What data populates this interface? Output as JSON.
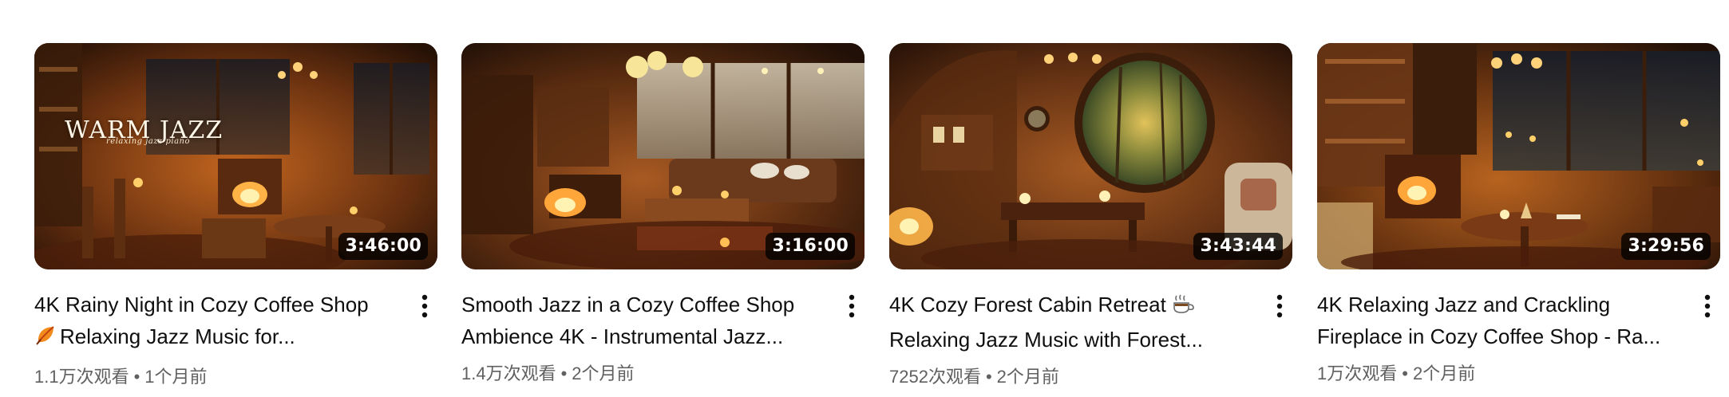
{
  "videos": [
    {
      "thumb_text": "WARM JAZZ",
      "thumb_subtext": "relaxing jazz piano",
      "duration": "3:46:00",
      "title_line1": "4K Rainy Night in Cozy Coffee Shop",
      "title_line2": "Relaxing Jazz Music for...",
      "title_icon": "autumn-leaf-icon",
      "views": "1.1万次观看",
      "separator": "•",
      "age": "1个月前"
    },
    {
      "duration": "3:16:00",
      "title_line1": "Smooth Jazz in a Cozy Coffee Shop",
      "title_line2": "Ambience 4K - Instrumental Jazz...",
      "views": "1.4万次观看",
      "separator": "•",
      "age": "2个月前"
    },
    {
      "duration": "3:43:44",
      "title_line1": "4K Cozy Forest Cabin Retreat",
      "title_line1_icon": "hot-beverage-icon",
      "title_line2": "Relaxing Jazz Music with Forest...",
      "views": "7252次观看",
      "separator": "•",
      "age": "2个月前"
    },
    {
      "duration": "3:29:56",
      "title_line1": "4K Relaxing Jazz and Crackling",
      "title_line2": "Fireplace in Cozy Coffee Shop - Ra...",
      "views": "1万次观看",
      "separator": "•",
      "age": "2个月前"
    }
  ],
  "colors": {
    "title": "#0f0f0f",
    "meta": "#606060",
    "duration_bg": "rgba(0,0,0,0.78)",
    "warm_light": "#f4a23c",
    "wood_dark": "#3b1e0c"
  },
  "icons": {
    "menu": "more-vertical-icon"
  }
}
